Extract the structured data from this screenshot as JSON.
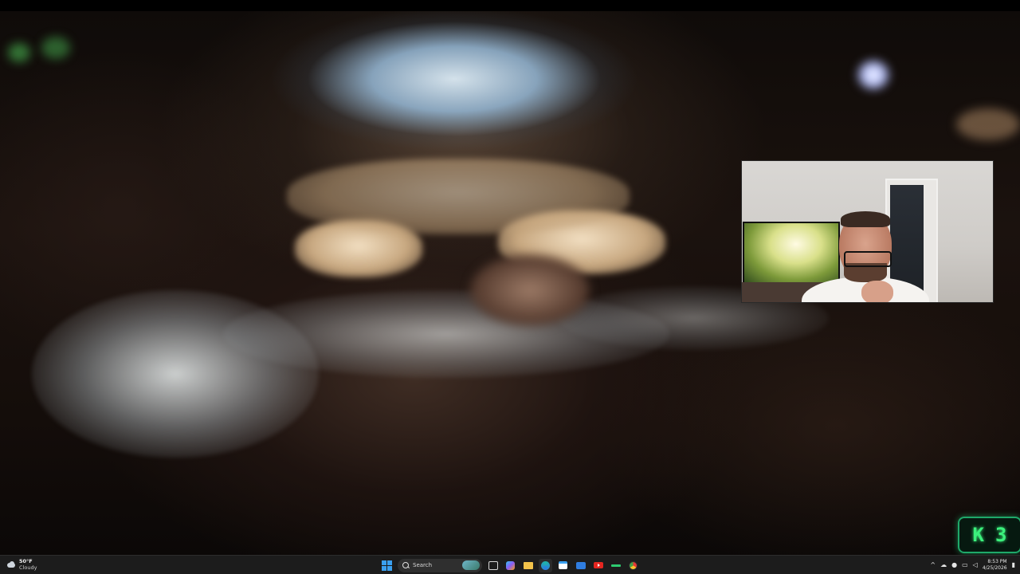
{
  "video": {
    "description_free": true
  },
  "overlay_badge": {
    "letter": "K",
    "number": "3",
    "color": "#3bf07c"
  },
  "taskbar": {
    "weather": {
      "temperature": "50°F",
      "condition": "Cloudy",
      "icon": "cloud-icon"
    },
    "search": {
      "placeholder": "Search"
    },
    "pinned_apps": [
      {
        "name": "start-icon"
      },
      {
        "name": "task-view-icon"
      },
      {
        "name": "copilot-icon"
      },
      {
        "name": "file-explorer-icon"
      },
      {
        "name": "edge-icon"
      },
      {
        "name": "store-icon"
      },
      {
        "name": "mail-icon"
      },
      {
        "name": "youtube-icon"
      },
      {
        "name": "app-icon"
      },
      {
        "name": "chrome-icon"
      }
    ],
    "clock": {
      "time": "8:53 PM",
      "date": "4/25/2026"
    },
    "colors": {
      "background": "#1c1c1c",
      "accent": "#3aa0f0"
    }
  }
}
